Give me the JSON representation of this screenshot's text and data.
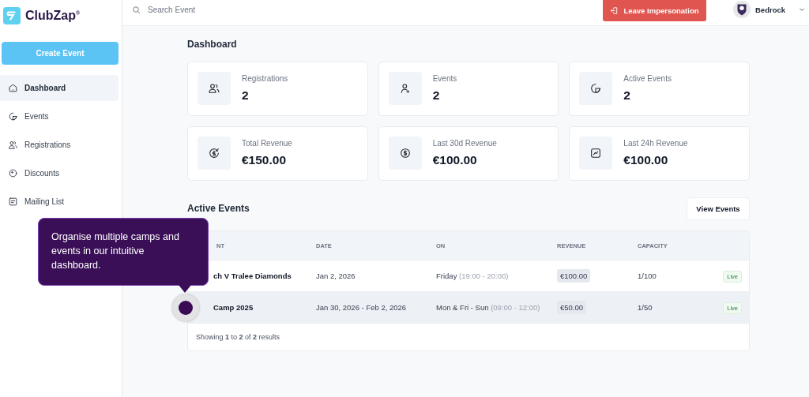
{
  "logo": {
    "name": "ClubZap",
    "mark": "®"
  },
  "create_button": "Create Event",
  "sidebar": {
    "items": [
      {
        "label": "Dashboard",
        "kind": "home",
        "selected": true
      },
      {
        "label": "Events",
        "kind": "pie",
        "selected": false
      },
      {
        "label": "Registrations",
        "kind": "users",
        "selected": false
      },
      {
        "label": "Discounts",
        "kind": "tag",
        "selected": false
      },
      {
        "label": "Mailing List",
        "kind": "list",
        "selected": false
      }
    ]
  },
  "search": {
    "placeholder": "Search Event"
  },
  "leave_button": "Leave Impersonation",
  "user": {
    "name": "Bedrock"
  },
  "title": "Dashboard",
  "stats": [
    {
      "label": "Registrations",
      "value": "2",
      "kind": "users"
    },
    {
      "label": "Events",
      "value": "2",
      "kind": "user-plus"
    },
    {
      "label": "Active Events",
      "value": "2",
      "kind": "pie"
    },
    {
      "label": "Total Revenue",
      "value": "€150.00",
      "kind": "coin-in"
    },
    {
      "label": "Last 30d Revenue",
      "value": "€100.00",
      "kind": "dollar"
    },
    {
      "label": "Last 24h Revenue",
      "value": "€100.00",
      "kind": "chart"
    }
  ],
  "active_events": {
    "title": "Active Events",
    "button": "View Events",
    "columns": [
      "NT",
      "DATE",
      "ON",
      "REVENUE",
      "CAPACITY"
    ],
    "rows": [
      {
        "event": "ch V Tralee Diamonds",
        "date": "Jan 2, 2026",
        "days": "Friday",
        "time": "(19:00 - 20:00)",
        "revenue": "€100.00",
        "capacity": "1/100",
        "status": "Live",
        "highlighted": false
      },
      {
        "event": "Camp 2025",
        "date": "Jan 30, 2026 - Feb 2, 2026",
        "days": "Mon & Fri - Sun",
        "time": "(09:00 - 12:00)",
        "revenue": "€50.00",
        "capacity": "1/50",
        "status": "Live",
        "highlighted": true
      }
    ],
    "footer": "Showing **1** to **2** of **2** results"
  },
  "tooltip": {
    "text": "Organise multiple camps and events in our intuitive dashboard."
  }
}
